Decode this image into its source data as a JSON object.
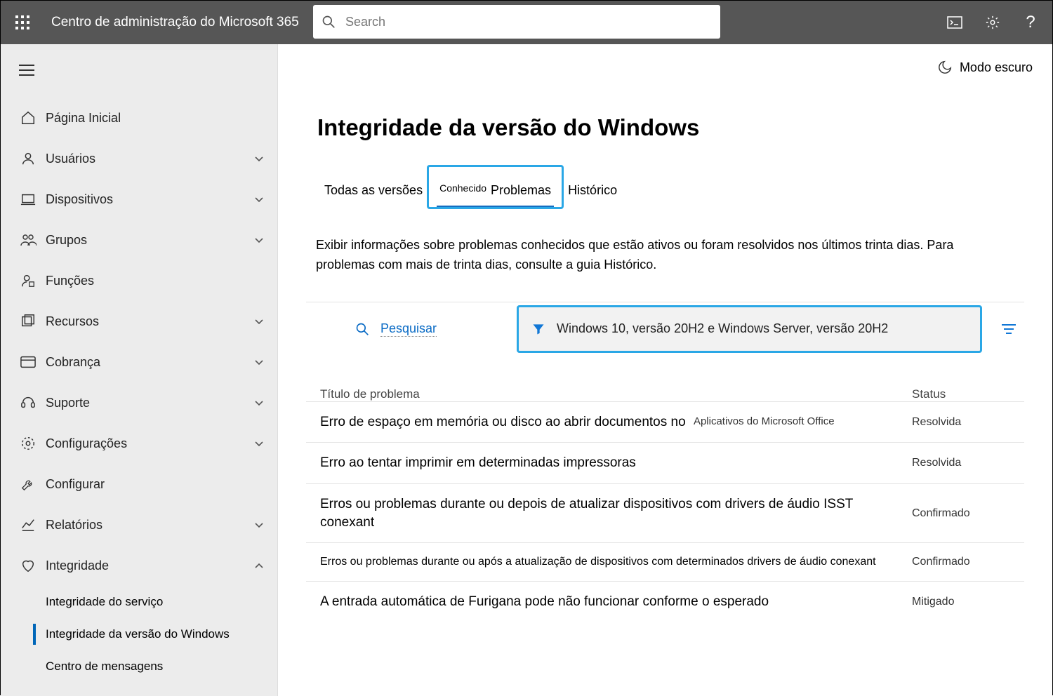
{
  "header": {
    "app_title": "Centro de administração do Microsoft 365",
    "search_placeholder": "Search"
  },
  "dark_mode_label": "Modo escuro",
  "sidebar": {
    "items": [
      {
        "label": "Página Inicial",
        "icon": "home",
        "expandable": false
      },
      {
        "label": "Usuários",
        "icon": "user",
        "expandable": true
      },
      {
        "label": "Dispositivos",
        "icon": "device",
        "expandable": true
      },
      {
        "label": "Grupos",
        "icon": "group",
        "expandable": true
      },
      {
        "label": "Funções",
        "icon": "role",
        "expandable": false
      },
      {
        "label": "Recursos",
        "icon": "resources",
        "expandable": true
      },
      {
        "label": "Cobrança",
        "icon": "billing",
        "expandable": true
      },
      {
        "label": "Suporte",
        "icon": "support",
        "expandable": true
      },
      {
        "label": "Configurações",
        "icon": "settings",
        "expandable": true
      },
      {
        "label": "Configurar",
        "icon": "setup",
        "expandable": false
      },
      {
        "label": "Relatórios",
        "icon": "reports",
        "expandable": true
      },
      {
        "label": "Integridade",
        "icon": "health",
        "expandable": true,
        "expanded": true,
        "subitems": [
          {
            "label": "Integridade do serviço",
            "selected": false
          },
          {
            "label": "Integridade da versão do Windows",
            "selected": true
          },
          {
            "label": "Centro de mensagens",
            "selected": false
          }
        ]
      }
    ]
  },
  "page": {
    "title": "Integridade da versão do Windows",
    "tabs": {
      "all_versions": "Todas as versões",
      "known_small": "Conhecido",
      "known_main": "Problemas",
      "history": "Histórico"
    },
    "description": "Exibir informações sobre problemas conhecidos que estão ativos ou foram resolvidos nos últimos trinta dias. Para problemas com mais de trinta dias, consulte a guia Histórico.",
    "toolbar": {
      "search_label": "Pesquisar",
      "filter_label": "Windows 10, versão 20H2 e Windows Server, versão 20H2"
    },
    "table": {
      "header_title": "Título de problema",
      "header_status": "Status",
      "rows": [
        {
          "title": "Erro de espaço em memória ou disco ao abrir documentos no",
          "extra": "Aplicativos do Microsoft Office",
          "status": "Resolvida"
        },
        {
          "title": "Erro ao tentar imprimir em determinadas impressoras",
          "extra": "",
          "status": "Resolvida"
        },
        {
          "title": "Erros ou problemas durante ou depois de atualizar dispositivos com drivers de áudio ISST conexant",
          "extra": "",
          "status": "Confirmado"
        },
        {
          "title": "Erros ou problemas durante ou após a atualização de dispositivos com determinados drivers de áudio conexant",
          "extra": "",
          "status": "Confirmado"
        },
        {
          "title": "A entrada automática de Furigana pode não funcionar conforme o esperado",
          "extra": "",
          "status": "Mitigado"
        }
      ]
    }
  }
}
